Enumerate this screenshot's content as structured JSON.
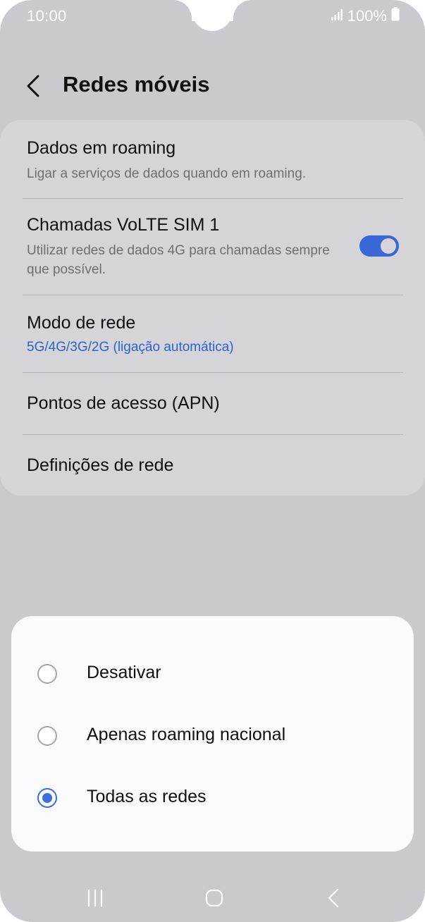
{
  "status_bar": {
    "time": "10:00",
    "battery": "100%",
    "icons": [
      "signal-icon",
      "battery-icon"
    ]
  },
  "header": {
    "title": "Redes móveis",
    "back_icon": "chevron-left-icon"
  },
  "settings": {
    "roaming": {
      "title": "Dados em roaming",
      "subtitle": "Ligar a serviços de dados quando em roaming."
    },
    "volte": {
      "title": "Chamadas VoLTE SIM 1",
      "subtitle": "Utilizar redes de dados 4G para chamadas sempre que possível.",
      "enabled": true
    },
    "network_mode": {
      "title": "Modo de rede",
      "value": "5G/4G/3G/2G (ligação automática)"
    },
    "apn": {
      "title": "Pontos de acesso (APN)"
    },
    "network_settings": {
      "title": "Definições de rede"
    }
  },
  "dialog": {
    "options": [
      {
        "label": "Desativar",
        "selected": false
      },
      {
        "label": "Apenas roaming nacional",
        "selected": false
      },
      {
        "label": "Todas as redes",
        "selected": true
      }
    ]
  },
  "nav_bar": {
    "icons": [
      "recent-apps-icon",
      "home-icon",
      "back-icon"
    ]
  },
  "colors": {
    "accent": "#3c6fdc",
    "link": "#2d63c8",
    "dim_background": "#c9c9ce"
  }
}
